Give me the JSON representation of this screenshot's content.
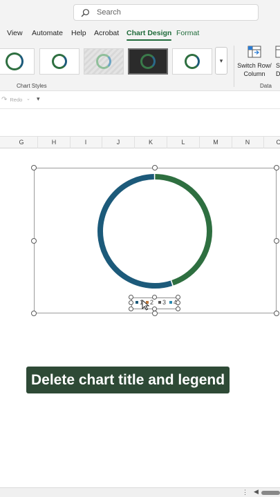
{
  "search": {
    "placeholder": "Search"
  },
  "ribbon_tabs": [
    "View",
    "Automate",
    "Help",
    "Acrobat",
    "Chart Design",
    "Format"
  ],
  "active_tab": "Chart Design",
  "chart_styles": {
    "group_label": "Chart Styles",
    "thumbnails": [
      "style-1",
      "style-2",
      "style-3",
      "style-4",
      "style-5"
    ],
    "selected": "style-4"
  },
  "data_group": {
    "label": "Data",
    "switch_button": "Switch Row/ Column",
    "select_button_partial": "S D"
  },
  "qat": {
    "redo_label": "Redo"
  },
  "columns": [
    "G",
    "H",
    "I",
    "J",
    "K",
    "L",
    "M",
    "N",
    "O"
  ],
  "chart_data": {
    "type": "pie",
    "variant": "doughnut",
    "title": "",
    "categories": [
      "1",
      "2",
      "3",
      "4"
    ],
    "values": [
      0,
      0,
      0.45,
      0.55
    ],
    "colors": [
      "#1c5a7a",
      "#2e6f40",
      "#2e6f40",
      "#1c5a7a"
    ],
    "legend": {
      "entries": [
        "1",
        "2",
        "3",
        "4"
      ],
      "placement": "bottom",
      "selected": true
    }
  },
  "caption": "Delete chart title and legend",
  "colors": {
    "accent": "#1f6b3a",
    "caption_bg": "#2e4a36",
    "ring_green": "#2e6f40",
    "ring_blue": "#1c5a7a"
  },
  "icons": [
    "search-icon",
    "more-styles-icon",
    "switch-row-column-icon",
    "redo-icon",
    "customize-qat-icon",
    "mouse-pointer-icon"
  ]
}
